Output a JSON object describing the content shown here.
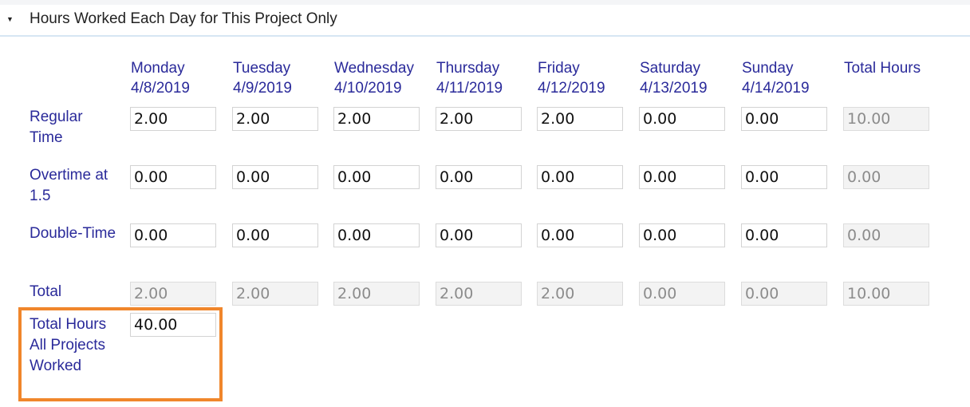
{
  "section": {
    "title": "Hours Worked Each Day for This Project Only"
  },
  "columns": [
    {
      "day": "Monday",
      "date": "4/8/2019"
    },
    {
      "day": "Tuesday",
      "date": "4/9/2019"
    },
    {
      "day": "Wednesday",
      "date": "4/10/2019"
    },
    {
      "day": "Thursday",
      "date": "4/11/2019"
    },
    {
      "day": "Friday",
      "date": "4/12/2019"
    },
    {
      "day": "Saturday",
      "date": "4/13/2019"
    },
    {
      "day": "Sunday",
      "date": "4/14/2019"
    },
    {
      "day": "Total Hours",
      "date": ""
    }
  ],
  "rows": [
    {
      "label": "Regular Time",
      "values": [
        "2.00",
        "2.00",
        "2.00",
        "2.00",
        "2.00",
        "0.00",
        "0.00"
      ],
      "total": "10.00"
    },
    {
      "label": "Overtime at 1.5",
      "values": [
        "0.00",
        "0.00",
        "0.00",
        "0.00",
        "0.00",
        "0.00",
        "0.00"
      ],
      "total": "0.00"
    },
    {
      "label": "Double-Time",
      "values": [
        "0.00",
        "0.00",
        "0.00",
        "0.00",
        "0.00",
        "0.00",
        "0.00"
      ],
      "total": "0.00"
    },
    {
      "label": "Total",
      "values": [
        "2.00",
        "2.00",
        "2.00",
        "2.00",
        "2.00",
        "0.00",
        "0.00"
      ],
      "total": "10.00"
    }
  ],
  "all_projects": {
    "label": "Total Hours All Projects Worked",
    "value": "40.00"
  },
  "colors": {
    "label": "#2a2a9a",
    "highlight": "#f0862b",
    "divider": "#d6e6f3"
  }
}
